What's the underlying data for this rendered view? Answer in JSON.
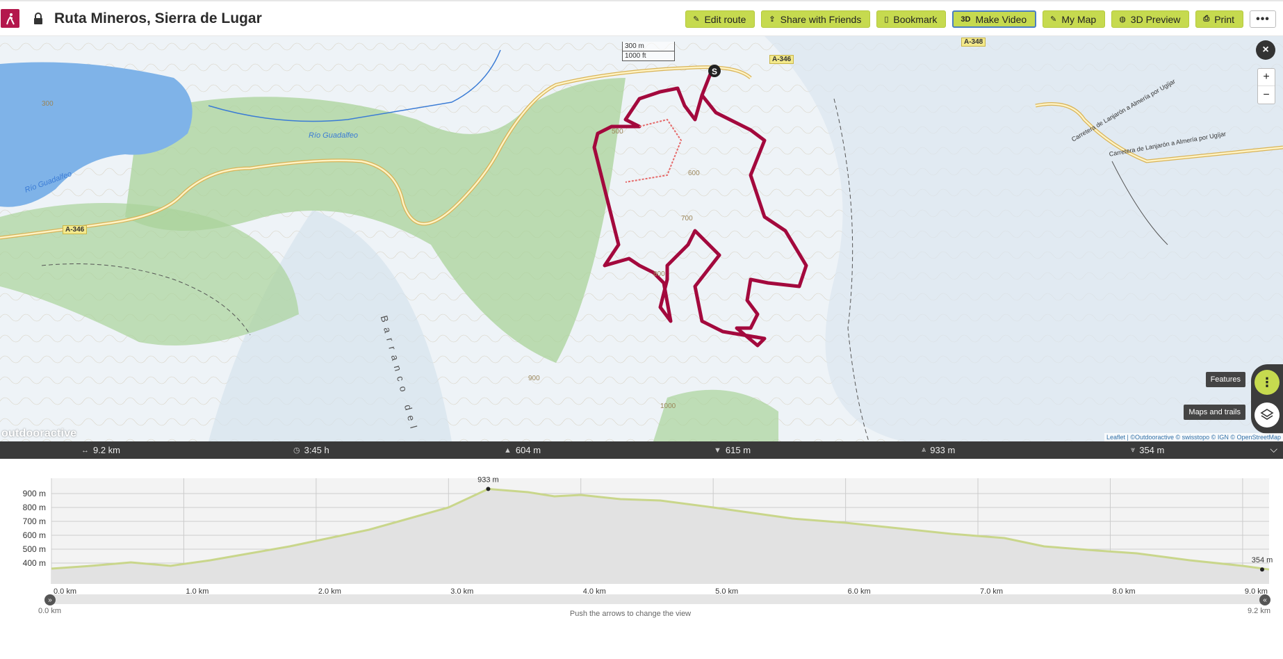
{
  "header": {
    "title": "Ruta Mineros, Sierra de Lugar",
    "buttons": [
      {
        "label": "Edit route",
        "icon": "edit-icon"
      },
      {
        "label": "Share with Friends",
        "icon": "share-icon"
      },
      {
        "label": "Bookmark",
        "icon": "bookmark-icon"
      },
      {
        "label": "Make Video",
        "icon": "3d-video-icon"
      },
      {
        "label": "My Map",
        "icon": "my-map-icon"
      },
      {
        "label": "3D Preview",
        "icon": "globe-icon"
      },
      {
        "label": "Print",
        "icon": "printer-icon"
      }
    ],
    "more": "•••",
    "video_icon_text": "3D"
  },
  "map": {
    "scale_m": "300 m",
    "scale_ft": "1000 ft",
    "roads": [
      "A-346",
      "A-348",
      "A-346"
    ],
    "labels": {
      "river1": "Río Guadalfeo",
      "river2": "Río Guadalfeo",
      "ravine": "Barranco del Olivo",
      "road_lanjaron1": "Carretera de Lanjarón a Almería por Ugíjar",
      "road_lanjaron2": "Carretera de Lanjarón a Almería por Ugíjar"
    },
    "contours": [
      "300",
      "500",
      "600",
      "700",
      "800",
      "900",
      "1000"
    ],
    "start_marker": "S",
    "features_label": "Features",
    "maps_trails_label": "Maps and trails",
    "brand": "outdooractive",
    "attribution": "Leaflet | ©Outdooractive © swisstopo © IGN © OpenStreetMap"
  },
  "stats": {
    "distance": "9.2 km",
    "duration": "3:45 h",
    "ascent": "604 m",
    "descent": "615 m",
    "highest": "933 m",
    "lowest": "354 m"
  },
  "elevation": {
    "y_ticks": [
      "900 m",
      "800 m",
      "700 m",
      "600 m",
      "500 m",
      "400 m"
    ],
    "x_ticks": [
      "0.0 km",
      "1.0 km",
      "2.0 km",
      "3.0 km",
      "4.0 km",
      "5.0 km",
      "6.0 km",
      "7.0 km",
      "8.0 km",
      "9.0 km"
    ],
    "max_label": "933 m",
    "min_label": "354 m",
    "profile": [
      [
        0.0,
        360
      ],
      [
        0.3,
        380
      ],
      [
        0.6,
        405
      ],
      [
        0.9,
        380
      ],
      [
        1.2,
        420
      ],
      [
        1.5,
        470
      ],
      [
        1.8,
        520
      ],
      [
        2.1,
        580
      ],
      [
        2.4,
        640
      ],
      [
        2.7,
        720
      ],
      [
        3.0,
        800
      ],
      [
        3.3,
        933
      ],
      [
        3.6,
        910
      ],
      [
        3.8,
        880
      ],
      [
        4.0,
        890
      ],
      [
        4.3,
        860
      ],
      [
        4.6,
        850
      ],
      [
        5.0,
        800
      ],
      [
        5.3,
        760
      ],
      [
        5.6,
        720
      ],
      [
        6.0,
        690
      ],
      [
        6.4,
        650
      ],
      [
        6.8,
        610
      ],
      [
        7.2,
        580
      ],
      [
        7.5,
        520
      ],
      [
        7.9,
        490
      ],
      [
        8.2,
        470
      ],
      [
        8.6,
        420
      ],
      [
        9.0,
        380
      ],
      [
        9.2,
        354
      ]
    ]
  },
  "slider": {
    "start": "0.0 km",
    "end": "9.2 km",
    "hint": "Push the arrows to change the view"
  }
}
